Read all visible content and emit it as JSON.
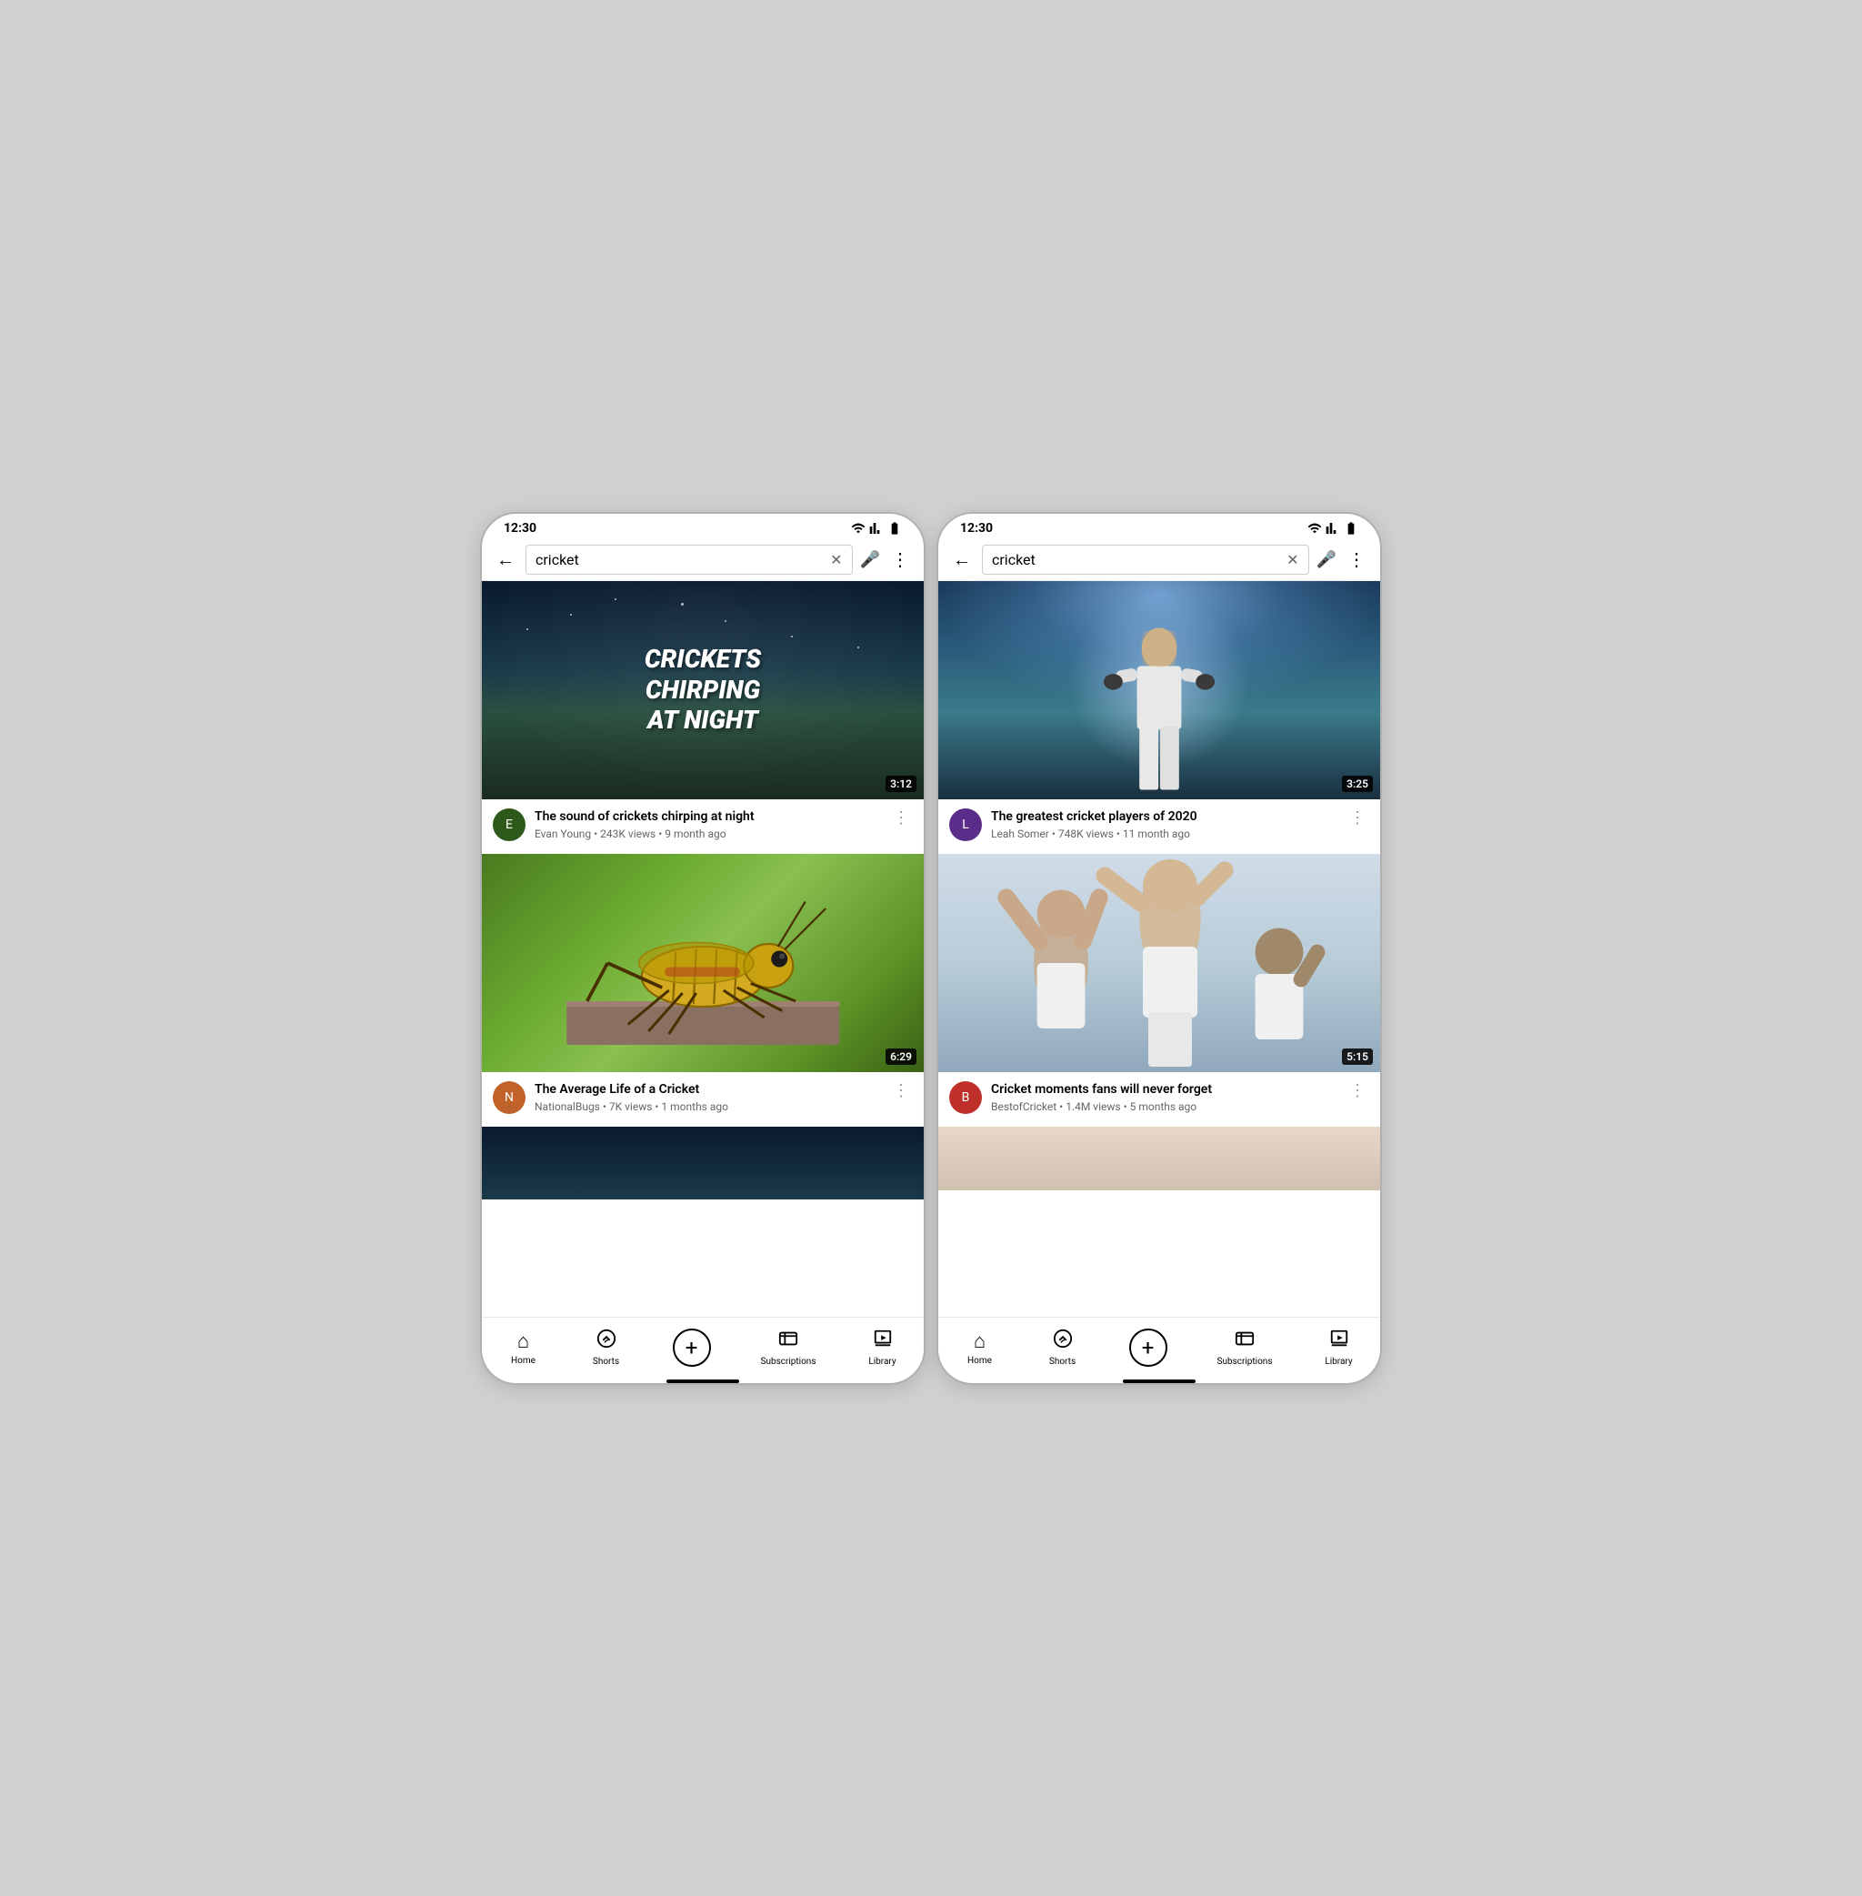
{
  "phones": [
    {
      "id": "left",
      "status": {
        "time": "12:30"
      },
      "search": {
        "query": "cricket",
        "back_label": "←",
        "clear_label": "✕",
        "mic_label": "🎤",
        "more_label": "⋮"
      },
      "videos": [
        {
          "id": "v1",
          "title": "The sound of crickets chirping at night",
          "channel": "Evan Young",
          "views": "243K views",
          "age": "9 month ago",
          "duration": "3:12",
          "thumb_type": "crickets-night",
          "thumb_text_line1": "CRICKETS",
          "thumb_text_line2": "CHIRPING",
          "thumb_text_line3": "AT NIGHT",
          "avatar_color": "avatar-green",
          "avatar_letter": "E"
        },
        {
          "id": "v2",
          "title": "The Average Life of a Cricket",
          "channel": "NationalBugs",
          "views": "7K views",
          "age": "1 months ago",
          "duration": "6:29",
          "thumb_type": "cricket-insect",
          "avatar_color": "avatar-orange",
          "avatar_letter": "N"
        }
      ],
      "nav": {
        "home": "Home",
        "shorts": "Shorts",
        "subscriptions": "Subscriptions",
        "library": "Library"
      }
    },
    {
      "id": "right",
      "status": {
        "time": "12:30"
      },
      "search": {
        "query": "cricket",
        "back_label": "←",
        "clear_label": "✕",
        "mic_label": "🎤",
        "more_label": "⋮"
      },
      "videos": [
        {
          "id": "v3",
          "title": "The greatest cricket players of 2020",
          "channel": "Leah Somer",
          "views": "748K views",
          "age": "11 month ago",
          "duration": "3:25",
          "thumb_type": "cricket-player",
          "avatar_color": "avatar-purple",
          "avatar_letter": "L"
        },
        {
          "id": "v4",
          "title": "Cricket moments fans will never forget",
          "channel": "BestofCricket",
          "views": "1.4M views",
          "age": "5 months ago",
          "duration": "5:15",
          "thumb_type": "cricket-celebration",
          "avatar_color": "avatar-red",
          "avatar_letter": "B"
        }
      ],
      "nav": {
        "home": "Home",
        "shorts": "Shorts",
        "subscriptions": "Subscriptions",
        "library": "Library"
      }
    }
  ]
}
